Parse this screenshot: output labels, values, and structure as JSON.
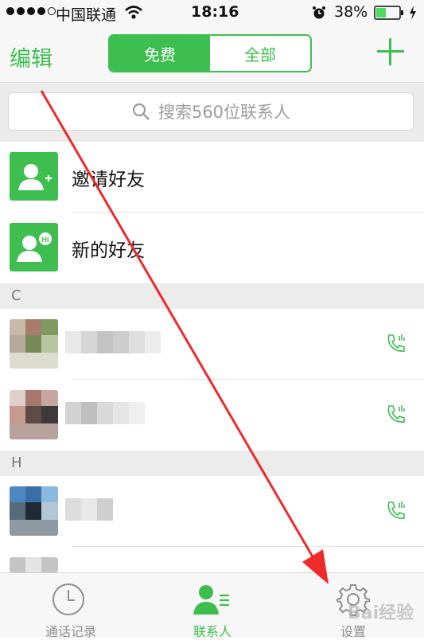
{
  "status": {
    "carrier": "中国联通",
    "time": "18:16",
    "battery": "38%"
  },
  "nav": {
    "edit": "编辑",
    "seg_free": "免费",
    "seg_all": "全部"
  },
  "search": {
    "placeholder": "搜索560位联系人"
  },
  "actions": [
    {
      "label": "邀请好友"
    },
    {
      "label": "新的好友"
    }
  ],
  "sections": [
    {
      "letter": "C"
    },
    {
      "letter": "H"
    }
  ],
  "tabs": [
    {
      "label": "通话记录"
    },
    {
      "label": "联系人"
    },
    {
      "label": "设置"
    }
  ],
  "watermark": "Bai经验",
  "colors": {
    "accent": "#3dbe4f",
    "arrow": "#ee2a2a"
  }
}
